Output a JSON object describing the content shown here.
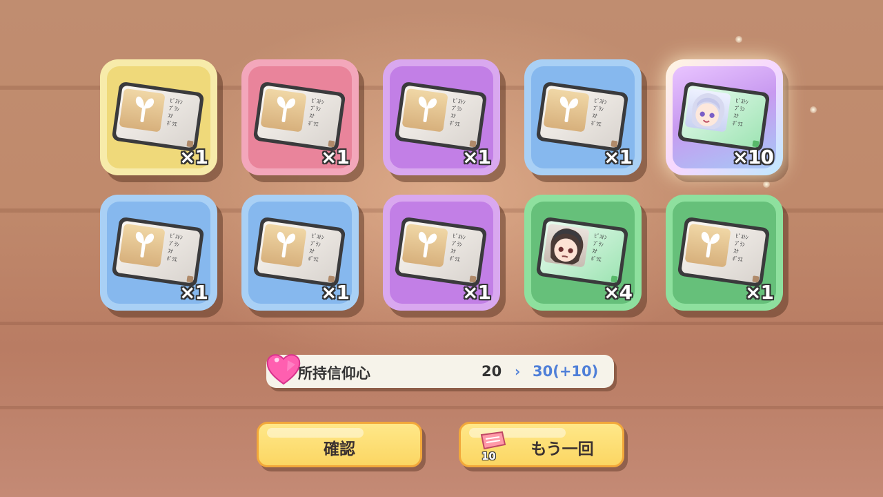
{
  "colors": {
    "faith_highlight": "#4f7fd8",
    "button_fill": "#fbd663",
    "button_border": "#f2a83a"
  },
  "rewards": [
    {
      "rarity": "yellow",
      "item": "ticket-sprout",
      "quantity": "×1"
    },
    {
      "rarity": "pink",
      "item": "ticket-sprout",
      "quantity": "×1"
    },
    {
      "rarity": "purple",
      "item": "ticket-sprout",
      "quantity": "×1"
    },
    {
      "rarity": "blue",
      "item": "ticket-sprout",
      "quantity": "×1"
    },
    {
      "rarity": "rainbow",
      "item": "ticket-character-silver-hair",
      "quantity": "×10"
    },
    {
      "rarity": "blue",
      "item": "ticket-sprout",
      "quantity": "×1"
    },
    {
      "rarity": "blue",
      "item": "ticket-sprout",
      "quantity": "×1"
    },
    {
      "rarity": "purple",
      "item": "ticket-sprout",
      "quantity": "×1"
    },
    {
      "rarity": "green",
      "item": "ticket-character-dark-hair",
      "quantity": "×4"
    },
    {
      "rarity": "green",
      "item": "ticket-sprout",
      "quantity": "×1"
    }
  ],
  "faith": {
    "icon": "heart-icon",
    "label": "所持信仰心",
    "from": "20",
    "arrow": "›",
    "to": "30(+10)"
  },
  "buttons": {
    "confirm_label": "確認",
    "again_label": "もう一回",
    "again_ticket_icon": "gacha-ticket-icon",
    "again_ticket_count": "10"
  }
}
